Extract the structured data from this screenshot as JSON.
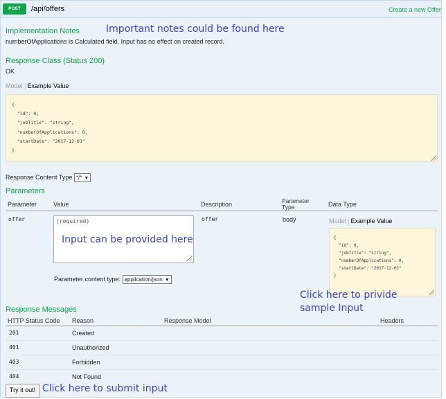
{
  "operation": {
    "method": "POST",
    "path": "/api/offers",
    "summary": "Create a new Offer"
  },
  "implementation": {
    "title": "Implementation Notes",
    "notes": "numberOfApplications is Calculated field. Input has no effect on created record."
  },
  "response_class": {
    "title": "Response Class (Status 200)",
    "value": "OK",
    "tab_model": "Model",
    "tab_example": "Example Value",
    "example_lines": [
      "{",
      "  \"id\": 0,",
      "  \"jobTitle\": \"string\",",
      "  \"numberOfApplications\": 0,",
      "  \"startDate\": \"2017-12-03\"",
      "}"
    ]
  },
  "response_content_type": {
    "label": "Response Content Type",
    "value": "*/*"
  },
  "parameters": {
    "title": "Parameters",
    "headers": [
      "Parameter",
      "Value",
      "Description",
      "Parameter Type",
      "Data Type"
    ],
    "row": {
      "name": "offer",
      "placeholder": "(required)",
      "description": "offer",
      "param_type": "body",
      "tab_model": "Model",
      "tab_example": "Example Value",
      "example_lines": [
        "{",
        "  \"id\": 0,",
        "  \"jobTitle\": \"string\",",
        "  \"numberOfApplications\": 0,",
        "  \"startDate\": \"2017-12-03\"",
        "}"
      ],
      "content_type_label": "Parameter content type:",
      "content_type_value": "application/json"
    }
  },
  "response_messages": {
    "title": "Response Messages",
    "headers": [
      "HTTP Status Code",
      "Reason",
      "Response Model",
      "Headers"
    ],
    "rows": [
      {
        "code": "201",
        "reason": "Created"
      },
      {
        "code": "401",
        "reason": "Unauthorized"
      },
      {
        "code": "403",
        "reason": "Forbidden"
      },
      {
        "code": "404",
        "reason": "Not Found"
      }
    ]
  },
  "try_button": "Try it out!",
  "annotations": {
    "notes": "Important notes could be found here",
    "input": "Input can be provided here",
    "sample_line1": "Click here to privide",
    "sample_line2": "sample Input",
    "submit": "Click here to submit input"
  },
  "colors": {
    "accent_green": "#10a54a",
    "panel_bg": "#ebf3f9",
    "code_bg": "#fcf6db",
    "annotation_blue": "#3a45c8"
  }
}
